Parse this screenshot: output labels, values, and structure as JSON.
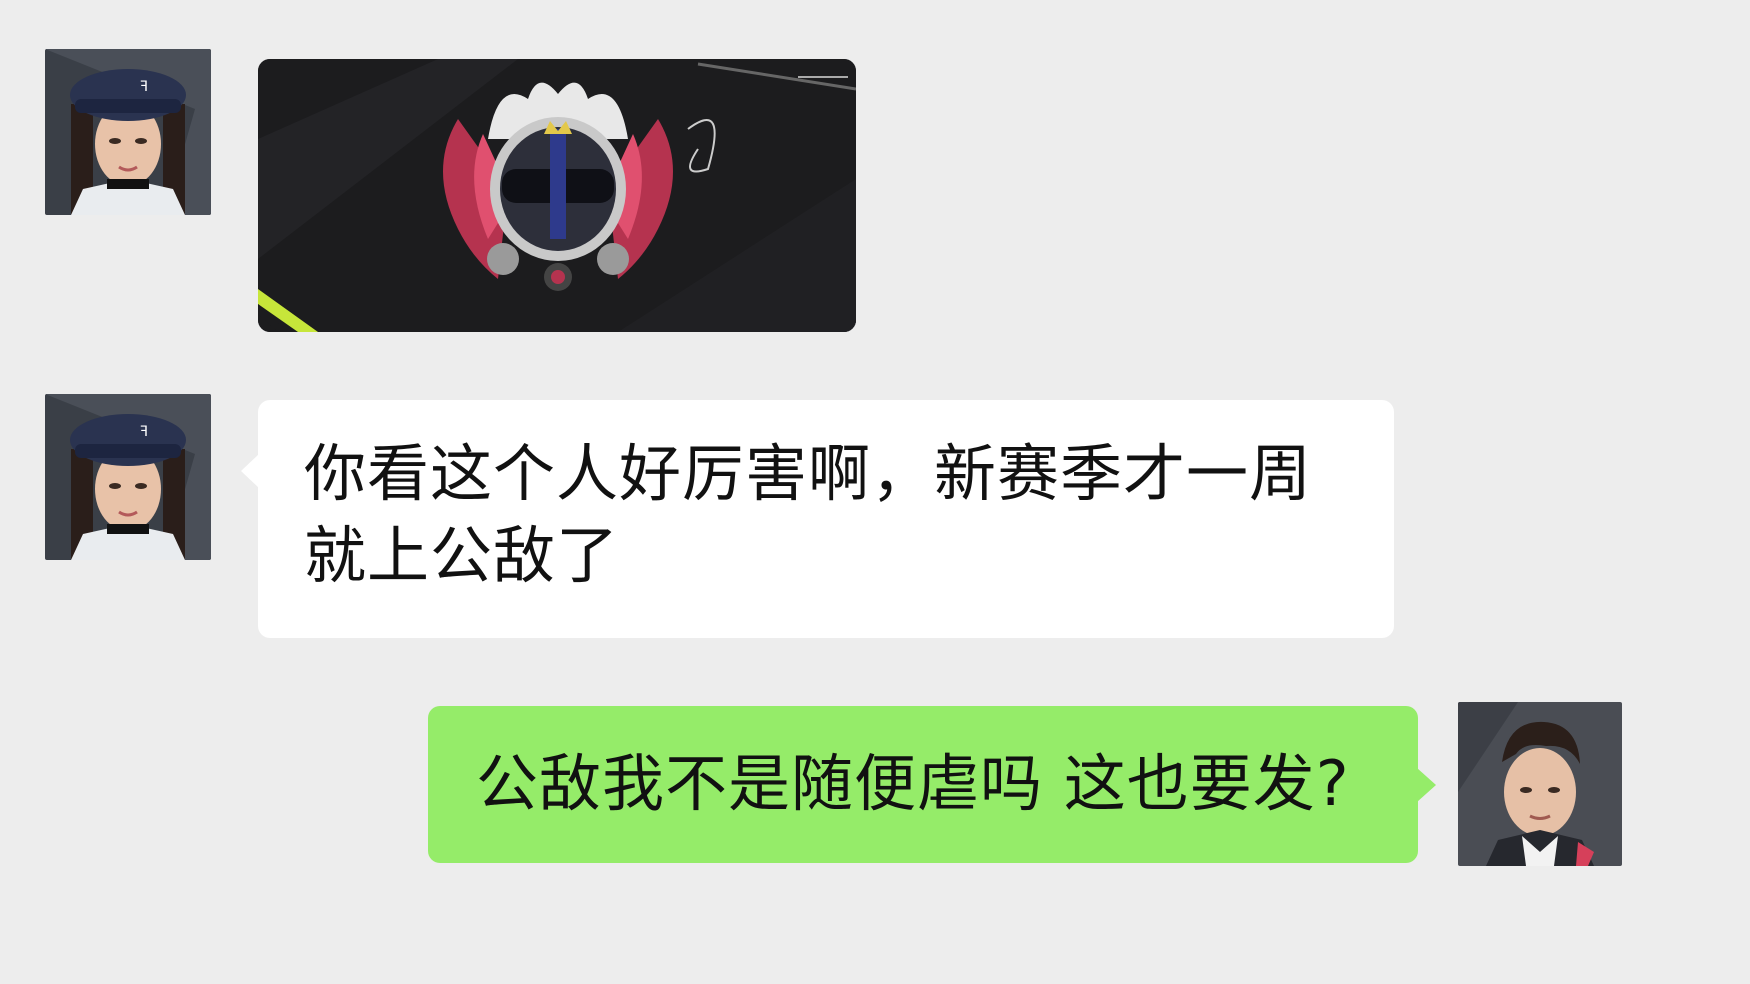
{
  "messages": [
    {
      "sender": "left",
      "type": "image",
      "image_icon": "racing-helmet-crown-emblem"
    },
    {
      "sender": "left",
      "type": "text",
      "text": "你看这个人好厉害啊，新赛季才一周就上公敌了"
    },
    {
      "sender": "right",
      "type": "text",
      "text": "公敌我不是随便虐吗 这也要发?"
    }
  ],
  "colors": {
    "background": "#ededed",
    "incoming_bubble": "#ffffff",
    "outgoing_bubble": "#95ec69"
  }
}
